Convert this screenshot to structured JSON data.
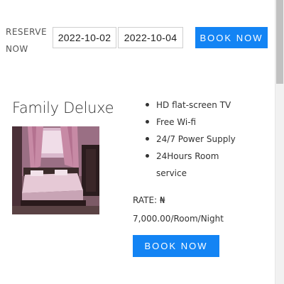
{
  "reserve": {
    "label_line1": "RESERVE",
    "label_line2": "NOW",
    "checkin_value": "2022-10-02",
    "checkout_value": "2022-10-04",
    "book_button": "BOOK NOW"
  },
  "room": {
    "title": "Family Deluxe",
    "photo_alt": "Bedroom with pink curtains",
    "amenities": [
      "HD flat-screen TV",
      "Free Wi-fi",
      "24/7 Power Supply",
      "24Hours Room service"
    ],
    "rate_line1": "RATE: ₦",
    "rate_line2": "7,000.00/Room/Night",
    "book_button": "BOOK NOW"
  },
  "colors": {
    "accent": "#1384f4"
  }
}
